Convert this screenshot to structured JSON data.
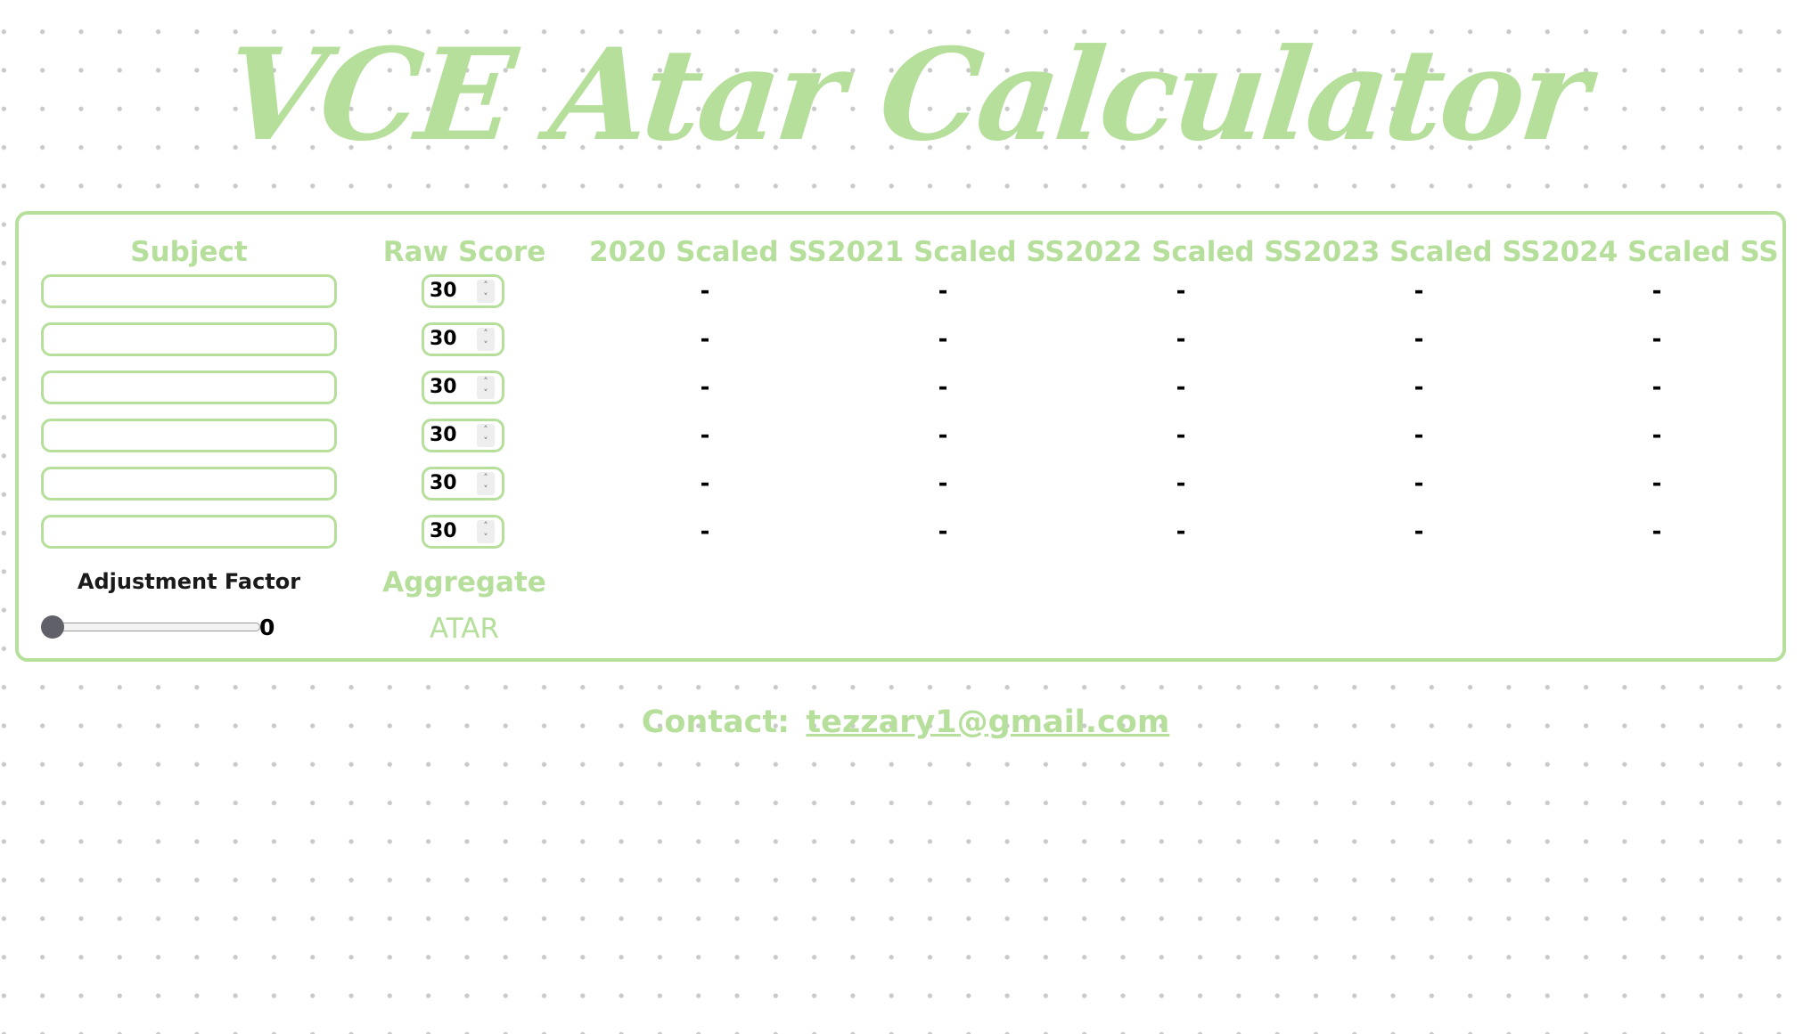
{
  "page": {
    "title": "VCE Atar Calculator"
  },
  "colors": {
    "accent_green": "#b5df9b",
    "text_dark": "#1a1a1a",
    "slider_thumb": "#5f6068",
    "dot_grid": "#c9c9c9"
  },
  "table": {
    "headers": {
      "subject": "Subject",
      "raw_score": "Raw Score",
      "years": [
        "2020 Scaled SS",
        "2021 Scaled SS",
        "2022 Scaled SS",
        "2023 Scaled SS",
        "2024 Scaled SS"
      ]
    },
    "rows": [
      {
        "subject": "",
        "raw_score": "30",
        "scaled": [
          "-",
          "-",
          "-",
          "-",
          "-"
        ]
      },
      {
        "subject": "",
        "raw_score": "30",
        "scaled": [
          "-",
          "-",
          "-",
          "-",
          "-"
        ]
      },
      {
        "subject": "",
        "raw_score": "30",
        "scaled": [
          "-",
          "-",
          "-",
          "-",
          "-"
        ]
      },
      {
        "subject": "",
        "raw_score": "30",
        "scaled": [
          "-",
          "-",
          "-",
          "-",
          "-"
        ]
      },
      {
        "subject": "",
        "raw_score": "30",
        "scaled": [
          "-",
          "-",
          "-",
          "-",
          "-"
        ]
      },
      {
        "subject": "",
        "raw_score": "30",
        "scaled": [
          "-",
          "-",
          "-",
          "-",
          "-"
        ]
      }
    ]
  },
  "adjustment": {
    "label": "Adjustment Factor",
    "value": "0",
    "slider_fraction": 0
  },
  "results": {
    "aggregate_label": "Aggregate",
    "atar_label": "ATAR"
  },
  "contact": {
    "label": "Contact:",
    "email": "tezzary1@gmail.com"
  },
  "icons": {
    "spinner_up": "chevron-up-icon",
    "spinner_down": "chevron-down-icon"
  }
}
